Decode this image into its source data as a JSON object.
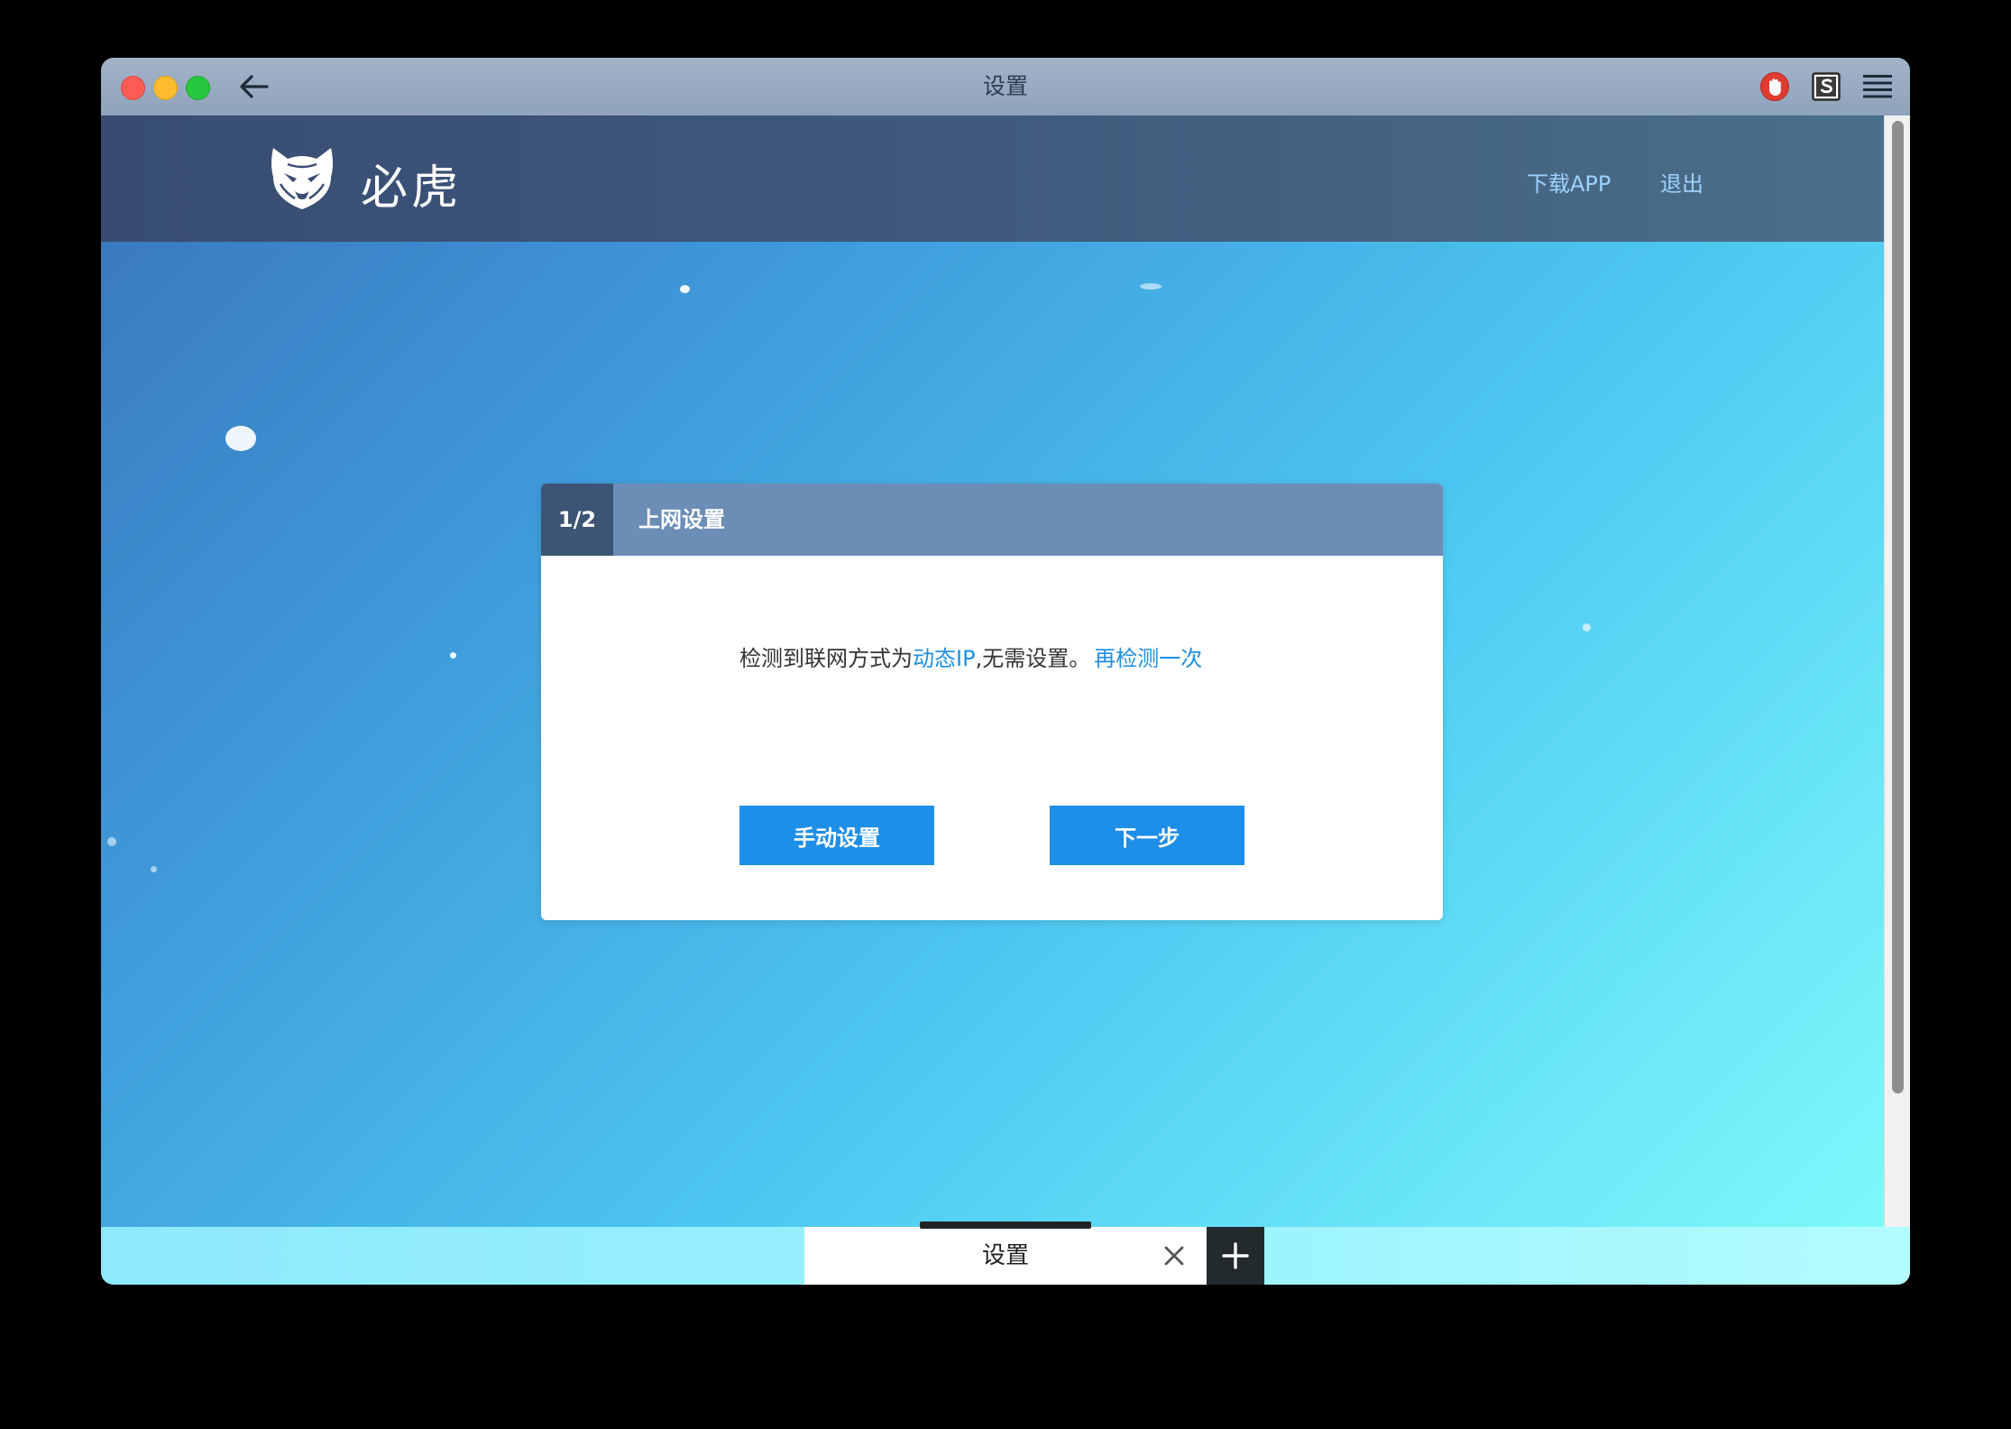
{
  "window": {
    "title": "设置"
  },
  "header": {
    "logo_text": "必虎",
    "nav": {
      "download_app": "下载APP",
      "logout": "退出"
    }
  },
  "card": {
    "step": "1/2",
    "title": "上网设置",
    "message": {
      "prefix": "检测到联网方式为",
      "mode": "动态IP",
      "suffix": ",无需设置。",
      "retry_link": "再检测一次"
    },
    "buttons": {
      "manual": "手动设置",
      "next": "下一步"
    }
  },
  "tabs": [
    {
      "label": "设置",
      "active": true
    }
  ],
  "icons": {
    "back": "back-arrow-icon",
    "stop": "stop-hand-icon",
    "s": "s-extension-icon",
    "menu": "hamburger-menu-icon",
    "close": "close-icon",
    "new_tab": "plus-icon",
    "logo": "tiger-logo-icon"
  },
  "colors": {
    "accent": "#1e8fe9",
    "link": "#1e8fe0",
    "nav_link": "#9fd2ff",
    "card_header": "#6c8db5",
    "step_badge": "#3c5574",
    "site_header": "#384c72"
  }
}
